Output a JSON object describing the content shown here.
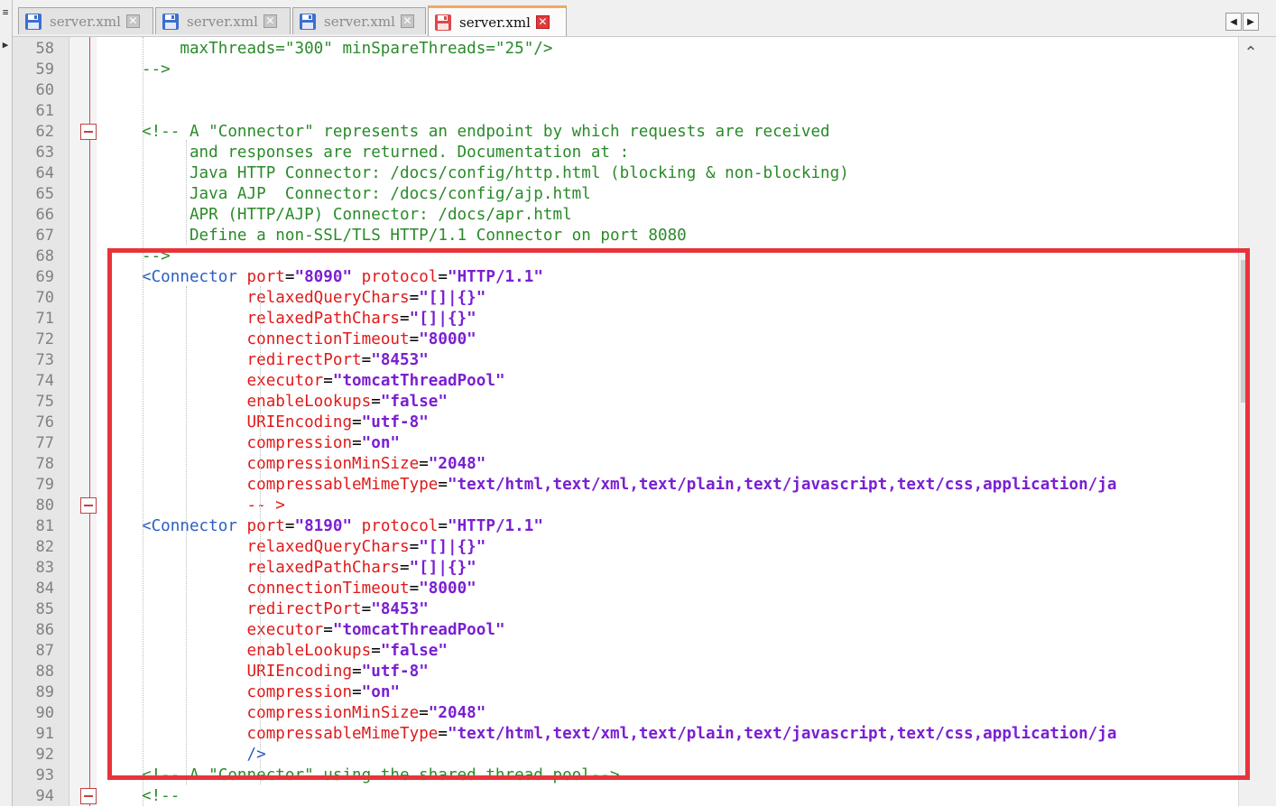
{
  "tabs": [
    {
      "label": "server.xml",
      "active": false
    },
    {
      "label": "server.xml",
      "active": false
    },
    {
      "label": "server.xml",
      "active": false
    },
    {
      "label": "server.xml",
      "active": true
    }
  ],
  "tab_nav": {
    "prev": "◀",
    "next": "▶"
  },
  "left_strip_buttons": [
    "≡",
    "▶"
  ],
  "colors": {
    "comment": "#2a8a2a",
    "tag": "#2c5ec0",
    "attribute": "#e01a1a",
    "value": "#7a1fd2",
    "highlight": "#e8333a",
    "active_tab_accent": "#f7a85e"
  },
  "scroll_up_glyph": "⌃",
  "icons": {
    "saved_file": "floppy-disk-blue-icon",
    "modified_file": "floppy-disk-red-icon",
    "close": "close-x-icon"
  },
  "lines": [
    {
      "n": "58",
      "segs": [
        {
          "c": "cm",
          "t": "    maxThreads=\"300\" minSpareThreads=\"25\"/>"
        }
      ]
    },
    {
      "n": "59",
      "segs": [
        {
          "c": "cm",
          "t": "-->"
        }
      ]
    },
    {
      "n": "60",
      "segs": []
    },
    {
      "n": "61",
      "segs": []
    },
    {
      "n": "62",
      "fold": true,
      "segs": [
        {
          "c": "cm",
          "t": "<!-- A \"Connector\" represents an endpoint by which requests are received"
        }
      ]
    },
    {
      "n": "63",
      "segs": [
        {
          "c": "cm",
          "t": "     and responses are returned. Documentation at :"
        }
      ]
    },
    {
      "n": "64",
      "segs": [
        {
          "c": "cm",
          "t": "     Java HTTP Connector: /docs/config/http.html (blocking & non-blocking)"
        }
      ]
    },
    {
      "n": "65",
      "segs": [
        {
          "c": "cm",
          "t": "     Java AJP  Connector: /docs/config/ajp.html"
        }
      ]
    },
    {
      "n": "66",
      "segs": [
        {
          "c": "cm",
          "t": "     APR (HTTP/AJP) Connector: /docs/apr.html"
        }
      ]
    },
    {
      "n": "67",
      "segs": [
        {
          "c": "cm",
          "t": "     Define a non-SSL/TLS HTTP/1.1 Connector on port 8080"
        }
      ]
    },
    {
      "n": "68",
      "segs": [
        {
          "c": "cm",
          "t": "-->"
        }
      ]
    },
    {
      "n": "69",
      "segs": [
        {
          "c": "tg",
          "t": "<Connector "
        },
        {
          "c": "at",
          "t": "port"
        },
        {
          "c": "",
          "t": "="
        },
        {
          "c": "vl",
          "t": "\"8090\""
        },
        {
          "c": "",
          "t": " "
        },
        {
          "c": "at",
          "t": "protocol"
        },
        {
          "c": "",
          "t": "="
        },
        {
          "c": "vl",
          "t": "\"HTTP/1.1\""
        }
      ]
    },
    {
      "n": "70",
      "segs": [
        {
          "c": "",
          "t": "           "
        },
        {
          "c": "at",
          "t": "relaxedQueryChars"
        },
        {
          "c": "",
          "t": "="
        },
        {
          "c": "vl",
          "t": "\"[]|{}\""
        }
      ]
    },
    {
      "n": "71",
      "segs": [
        {
          "c": "",
          "t": "           "
        },
        {
          "c": "at",
          "t": "relaxedPathChars"
        },
        {
          "c": "",
          "t": "="
        },
        {
          "c": "vl",
          "t": "\"[]|{}\""
        }
      ]
    },
    {
      "n": "72",
      "segs": [
        {
          "c": "",
          "t": "           "
        },
        {
          "c": "at",
          "t": "connectionTimeout"
        },
        {
          "c": "",
          "t": "="
        },
        {
          "c": "vl",
          "t": "\"8000\""
        }
      ]
    },
    {
      "n": "73",
      "segs": [
        {
          "c": "",
          "t": "           "
        },
        {
          "c": "at",
          "t": "redirectPort"
        },
        {
          "c": "",
          "t": "="
        },
        {
          "c": "vl",
          "t": "\"8453\""
        }
      ]
    },
    {
      "n": "74",
      "segs": [
        {
          "c": "",
          "t": "           "
        },
        {
          "c": "at",
          "t": "executor"
        },
        {
          "c": "",
          "t": "="
        },
        {
          "c": "vl",
          "t": "\"tomcatThreadPool\""
        }
      ]
    },
    {
      "n": "75",
      "segs": [
        {
          "c": "",
          "t": "           "
        },
        {
          "c": "at",
          "t": "enableLookups"
        },
        {
          "c": "",
          "t": "="
        },
        {
          "c": "vl",
          "t": "\"false\""
        }
      ]
    },
    {
      "n": "76",
      "segs": [
        {
          "c": "",
          "t": "           "
        },
        {
          "c": "at",
          "t": "URIEncoding"
        },
        {
          "c": "",
          "t": "="
        },
        {
          "c": "vl",
          "t": "\"utf-8\""
        }
      ]
    },
    {
      "n": "77",
      "segs": [
        {
          "c": "",
          "t": "           "
        },
        {
          "c": "at",
          "t": "compression"
        },
        {
          "c": "",
          "t": "="
        },
        {
          "c": "vl",
          "t": "\"on\""
        }
      ]
    },
    {
      "n": "78",
      "segs": [
        {
          "c": "",
          "t": "           "
        },
        {
          "c": "at",
          "t": "compressionMinSize"
        },
        {
          "c": "",
          "t": "="
        },
        {
          "c": "vl",
          "t": "\"2048\""
        }
      ]
    },
    {
      "n": "79",
      "segs": [
        {
          "c": "",
          "t": "           "
        },
        {
          "c": "at",
          "t": "compressableMimeType"
        },
        {
          "c": "",
          "t": "="
        },
        {
          "c": "vl",
          "t": "\"text/html,text/xml,text/plain,text/javascript,text/css,application/ja"
        }
      ]
    },
    {
      "n": "80",
      "fold": true,
      "segs": [
        {
          "c": "",
          "t": "           "
        },
        {
          "c": "at",
          "t": "-- >"
        }
      ]
    },
    {
      "n": "81",
      "segs": [
        {
          "c": "tg",
          "t": "<Connector "
        },
        {
          "c": "at",
          "t": "port"
        },
        {
          "c": "",
          "t": "="
        },
        {
          "c": "vl",
          "t": "\"8190\""
        },
        {
          "c": "",
          "t": " "
        },
        {
          "c": "at",
          "t": "protocol"
        },
        {
          "c": "",
          "t": "="
        },
        {
          "c": "vl",
          "t": "\"HTTP/1.1\""
        }
      ]
    },
    {
      "n": "82",
      "segs": [
        {
          "c": "",
          "t": "           "
        },
        {
          "c": "at",
          "t": "relaxedQueryChars"
        },
        {
          "c": "",
          "t": "="
        },
        {
          "c": "vl",
          "t": "\"[]|{}\""
        }
      ]
    },
    {
      "n": "83",
      "segs": [
        {
          "c": "",
          "t": "           "
        },
        {
          "c": "at",
          "t": "relaxedPathChars"
        },
        {
          "c": "",
          "t": "="
        },
        {
          "c": "vl",
          "t": "\"[]|{}\""
        }
      ]
    },
    {
      "n": "84",
      "segs": [
        {
          "c": "",
          "t": "           "
        },
        {
          "c": "at",
          "t": "connectionTimeout"
        },
        {
          "c": "",
          "t": "="
        },
        {
          "c": "vl",
          "t": "\"8000\""
        }
      ]
    },
    {
      "n": "85",
      "segs": [
        {
          "c": "",
          "t": "           "
        },
        {
          "c": "at",
          "t": "redirectPort"
        },
        {
          "c": "",
          "t": "="
        },
        {
          "c": "vl",
          "t": "\"8453\""
        }
      ]
    },
    {
      "n": "86",
      "segs": [
        {
          "c": "",
          "t": "           "
        },
        {
          "c": "at",
          "t": "executor"
        },
        {
          "c": "",
          "t": "="
        },
        {
          "c": "vl",
          "t": "\"tomcatThreadPool\""
        }
      ]
    },
    {
      "n": "87",
      "segs": [
        {
          "c": "",
          "t": "           "
        },
        {
          "c": "at",
          "t": "enableLookups"
        },
        {
          "c": "",
          "t": "="
        },
        {
          "c": "vl",
          "t": "\"false\""
        }
      ]
    },
    {
      "n": "88",
      "segs": [
        {
          "c": "",
          "t": "           "
        },
        {
          "c": "at",
          "t": "URIEncoding"
        },
        {
          "c": "",
          "t": "="
        },
        {
          "c": "vl",
          "t": "\"utf-8\""
        }
      ]
    },
    {
      "n": "89",
      "segs": [
        {
          "c": "",
          "t": "           "
        },
        {
          "c": "at",
          "t": "compression"
        },
        {
          "c": "",
          "t": "="
        },
        {
          "c": "vl",
          "t": "\"on\""
        }
      ]
    },
    {
      "n": "90",
      "segs": [
        {
          "c": "",
          "t": "           "
        },
        {
          "c": "at",
          "t": "compressionMinSize"
        },
        {
          "c": "",
          "t": "="
        },
        {
          "c": "vl",
          "t": "\"2048\""
        }
      ]
    },
    {
      "n": "91",
      "segs": [
        {
          "c": "",
          "t": "           "
        },
        {
          "c": "at",
          "t": "compressableMimeType"
        },
        {
          "c": "",
          "t": "="
        },
        {
          "c": "vl",
          "t": "\"text/html,text/xml,text/plain,text/javascript,text/css,application/ja"
        }
      ]
    },
    {
      "n": "92",
      "segs": [
        {
          "c": "",
          "t": "           "
        },
        {
          "c": "tg",
          "t": "/>"
        }
      ]
    },
    {
      "n": "93",
      "segs": [
        {
          "c": "cm",
          "t": "<!-- A \"Connector\" using the shared thread pool-->"
        }
      ]
    },
    {
      "n": "94",
      "fold": true,
      "segs": [
        {
          "c": "cm",
          "t": "<!--"
        }
      ]
    }
  ]
}
